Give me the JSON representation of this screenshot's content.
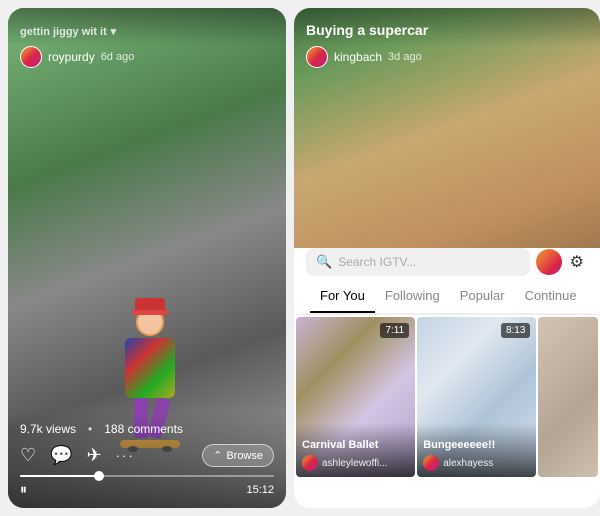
{
  "left_panel": {
    "title": "gettin jiggy wit it",
    "title_suffix": "▾",
    "username": "roypurdy",
    "time_ago": "6d ago",
    "views": "9.7k views",
    "dot": "•",
    "comments": "188 comments",
    "browse_label": "Browse",
    "browse_icon": "⌃",
    "duration": "15:12",
    "play_icon": "⏸"
  },
  "right_panel": {
    "title": "Buying a supercar",
    "username": "kingbach",
    "time_ago": "3d ago",
    "search_placeholder": "Search IGTV...",
    "tabs": [
      {
        "label": "For You",
        "active": true
      },
      {
        "label": "Following",
        "active": false
      },
      {
        "label": "Popular",
        "active": false
      },
      {
        "label": "Continue",
        "active": false
      }
    ],
    "grid": [
      {
        "title": "Carnival Ballet",
        "username": "ashleylewoffi...",
        "duration": "7:11"
      },
      {
        "title": "Bungeeeeee!!",
        "username": "alexhayess",
        "duration": "8:13"
      },
      {
        "title": "",
        "username": "",
        "duration": ""
      }
    ]
  },
  "icons": {
    "heart": "♡",
    "comment": "💬",
    "share": "✈",
    "more": "•••",
    "search": "🔍",
    "profile": "👤",
    "gear": "⚙",
    "browse_chevron": "⌃"
  }
}
